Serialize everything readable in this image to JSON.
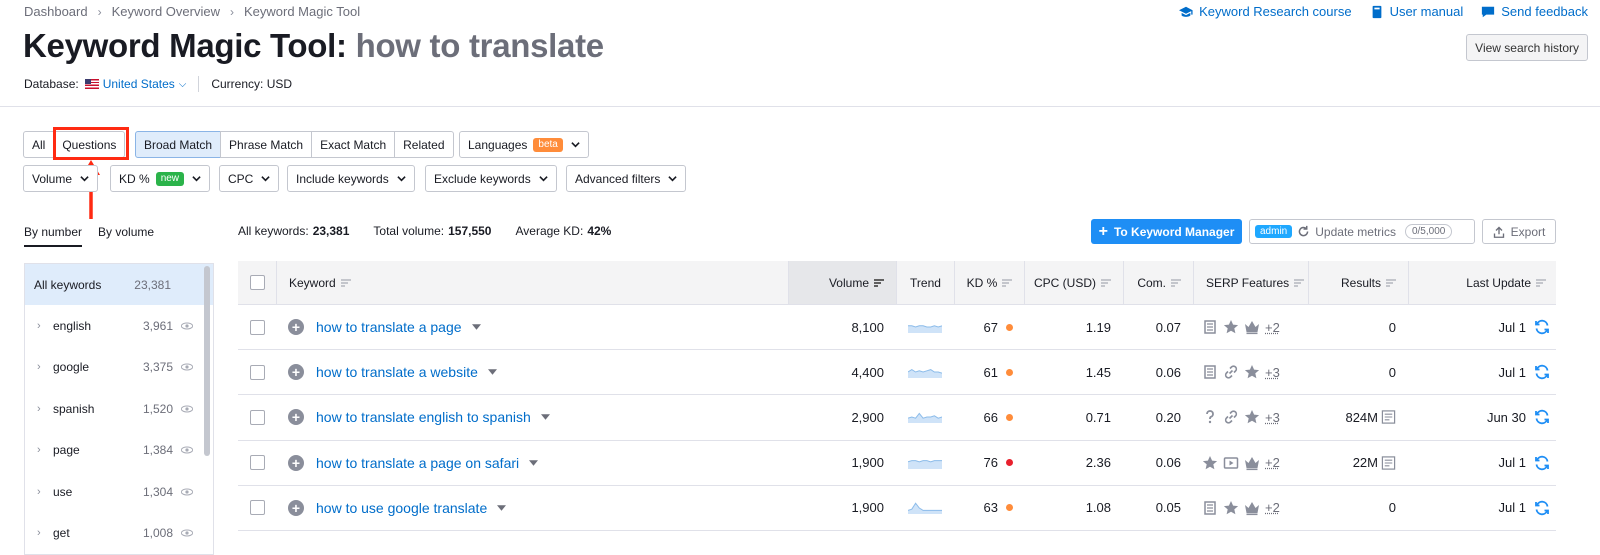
{
  "breadcrumb": [
    "Dashboard",
    "Keyword Overview",
    "Keyword Magic Tool"
  ],
  "top_links": [
    {
      "label": "Keyword Research course",
      "icon": "graduation-cap-icon"
    },
    {
      "label": "User manual",
      "icon": "book-icon"
    },
    {
      "label": "Send feedback",
      "icon": "chat-bubble-icon"
    }
  ],
  "title": {
    "tool": "Keyword Magic Tool:",
    "query": "how to translate"
  },
  "history_button": "View search history",
  "database": {
    "label": "Database:",
    "country": "United States",
    "currency": "Currency: USD"
  },
  "filters": {
    "type_tabs": [
      "All",
      "Questions"
    ],
    "match_tabs": [
      "Broad Match",
      "Phrase Match",
      "Exact Match",
      "Related"
    ],
    "languages": {
      "label": "Languages",
      "badge": "beta"
    },
    "row2": [
      {
        "label": "Volume"
      },
      {
        "label": "KD %",
        "badge": "new"
      },
      {
        "label": "CPC"
      },
      {
        "label": "Include keywords"
      },
      {
        "label": "Exclude keywords"
      },
      {
        "label": "Advanced filters"
      }
    ]
  },
  "side_tabs": [
    "By number",
    "By volume"
  ],
  "sidebar": {
    "all": {
      "label": "All keywords",
      "count": "23,381"
    },
    "groups": [
      {
        "label": "english",
        "count": "3,961"
      },
      {
        "label": "google",
        "count": "3,375"
      },
      {
        "label": "spanish",
        "count": "1,520"
      },
      {
        "label": "page",
        "count": "1,384"
      },
      {
        "label": "use",
        "count": "1,304"
      },
      {
        "label": "get",
        "count": "1,008"
      }
    ]
  },
  "stats": {
    "all_label": "All keywords:",
    "all_value": "23,381",
    "volume_label": "Total volume:",
    "volume_value": "157,550",
    "kd_label": "Average KD:",
    "kd_value": "42%"
  },
  "actions": {
    "manager": "To Keyword Manager",
    "admin_badge": "admin",
    "update": "Update metrics",
    "quota": "0/5,000",
    "export": "Export"
  },
  "table": {
    "headers": [
      "Keyword",
      "Volume",
      "Trend",
      "KD %",
      "CPC (USD)",
      "Com.",
      "SERP Features",
      "Results",
      "Last Update"
    ],
    "rows": [
      {
        "keyword": "how to translate a page",
        "volume": "8,100",
        "kd": "67",
        "kd_color": "#ff8c3a",
        "cpc": "1.19",
        "com": "0.07",
        "features": [
          "page-icon",
          "star-icon",
          "crown-icon"
        ],
        "more": "+2",
        "results": "0",
        "results_icon": false,
        "updated": "Jul 1",
        "trend": [
          6,
          6,
          5,
          6,
          6,
          5,
          5,
          6,
          5,
          6
        ]
      },
      {
        "keyword": "how to translate a website",
        "volume": "4,400",
        "kd": "61",
        "kd_color": "#ff8c3a",
        "cpc": "1.45",
        "com": "0.06",
        "features": [
          "page-icon",
          "link-icon",
          "star-icon"
        ],
        "more": "+3",
        "results": "0",
        "results_icon": false,
        "updated": "Jul 1",
        "trend": [
          5,
          7,
          5,
          6,
          5,
          6,
          7,
          5,
          5,
          4
        ]
      },
      {
        "keyword": "how to translate english to spanish",
        "volume": "2,900",
        "kd": "66",
        "kd_color": "#ff8c3a",
        "cpc": "0.71",
        "com": "0.20",
        "features": [
          "question-icon",
          "link-icon",
          "star-icon"
        ],
        "more": "+3",
        "results": "824M",
        "results_icon": true,
        "updated": "Jun 30",
        "trend": [
          4,
          5,
          4,
          8,
          4,
          5,
          5,
          6,
          4,
          5
        ]
      },
      {
        "keyword": "how to translate a page on safari",
        "volume": "1,900",
        "kd": "76",
        "kd_color": "#e8202d",
        "cpc": "2.36",
        "com": "0.06",
        "features": [
          "star-icon",
          "video-icon",
          "crown-icon"
        ],
        "more": "+2",
        "results": "22M",
        "results_icon": true,
        "updated": "Jul 1",
        "trend": [
          6,
          7,
          7,
          6,
          7,
          7,
          6,
          7,
          7,
          7
        ]
      },
      {
        "keyword": "how to use google translate",
        "volume": "1,900",
        "kd": "63",
        "kd_color": "#ff8c3a",
        "cpc": "1.08",
        "com": "0.05",
        "features": [
          "page-icon",
          "star-icon",
          "crown-icon"
        ],
        "more": "+2",
        "results": "0",
        "results_icon": false,
        "updated": "Jul 1",
        "trend": [
          3,
          4,
          9,
          5,
          3,
          3,
          3,
          3,
          3,
          3
        ]
      }
    ]
  },
  "colors": {
    "accent": "#006dca",
    "primary_button": "#1e8ef5",
    "highlight": "#ff2a12"
  }
}
